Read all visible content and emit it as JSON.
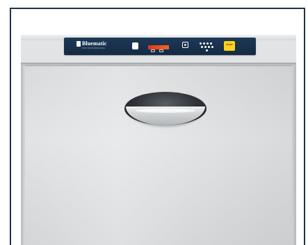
{
  "product": {
    "brand_name": "Bluematic",
    "brand_tagline": "BLUE THE PROFESSIONAL",
    "start_label": "START"
  },
  "colors": {
    "frame_border": "#1f3346",
    "control_panel": "#1a3350",
    "display_red": "#e2321b",
    "start_yellow": "#ffd21a",
    "steel": "#d8dadc"
  },
  "icons": {
    "power": "power-button-icon",
    "timer": "timer-icon",
    "programs": "program-selector-icon"
  }
}
